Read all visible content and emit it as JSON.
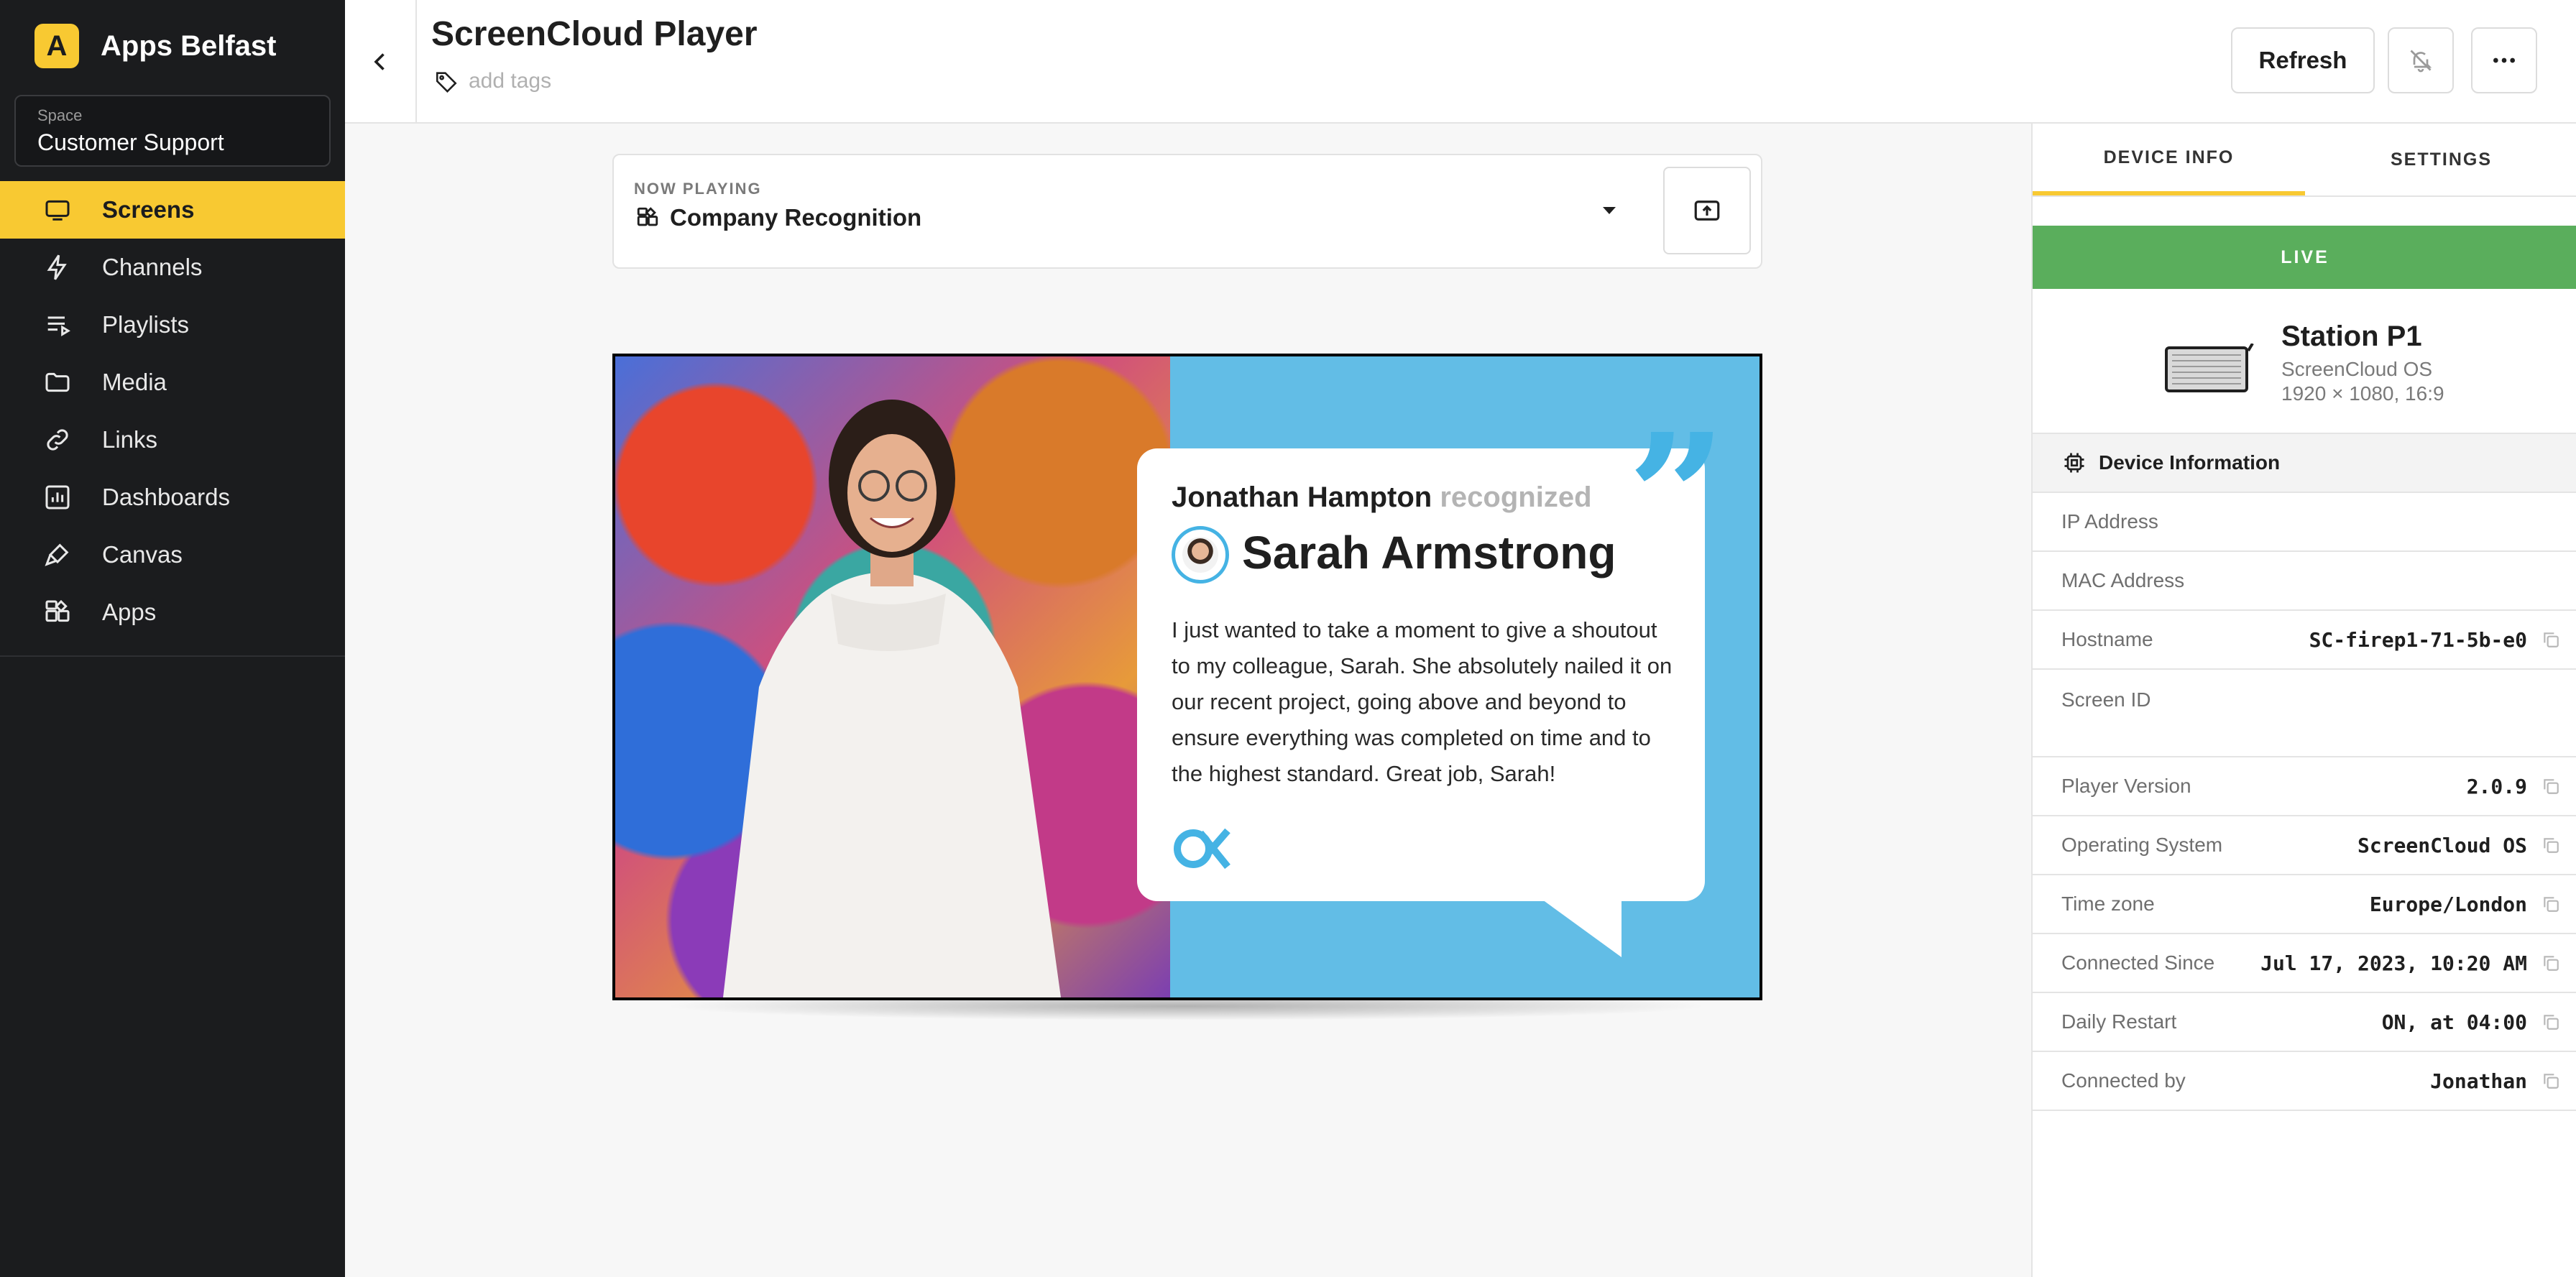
{
  "app": {
    "org_initial": "A",
    "org_name": "Apps Belfast",
    "space_label": "Space",
    "space_value": "Customer Support",
    "accent_color": "#f8c932"
  },
  "sidebar": {
    "items": [
      {
        "label": "Screens",
        "icon": "monitor-icon",
        "active": true
      },
      {
        "label": "Channels",
        "icon": "lightning-icon"
      },
      {
        "label": "Playlists",
        "icon": "playlist-icon"
      },
      {
        "label": "Media",
        "icon": "folder-icon"
      },
      {
        "label": "Links",
        "icon": "link-icon"
      },
      {
        "label": "Dashboards",
        "icon": "dashboard-icon"
      },
      {
        "label": "Canvas",
        "icon": "brush-icon"
      },
      {
        "label": "Apps",
        "icon": "apps-icon"
      }
    ]
  },
  "header": {
    "title": "ScreenCloud Player",
    "tags_placeholder": "add tags",
    "refresh_label": "Refresh"
  },
  "now_playing": {
    "label": "NOW PLAYING",
    "value": "Company Recognition"
  },
  "preview": {
    "from": "Jonathan Hampton",
    "verb": "recognized",
    "to": "Sarah Armstrong",
    "message": "I just wanted to take a moment to give a shoutout to my colleague, Sarah. She absolutely nailed it on our recent project, going above and beyond to ensure everything was completed on time and to the highest standard. Great job, Sarah!"
  },
  "panel": {
    "tabs": [
      "DEVICE INFO",
      "SETTINGS"
    ],
    "status": "LIVE",
    "status_color": "#5aae5c",
    "device_name": "Station P1",
    "device_os": "ScreenCloud OS",
    "device_res": "1920 × 1080, 16:9",
    "section_title": "Device Information",
    "rows": [
      {
        "label": "IP Address",
        "value": ""
      },
      {
        "label": "MAC Address",
        "value": ""
      },
      {
        "label": "Hostname",
        "value": "SC-firep1-71-5b-e0"
      },
      {
        "label": "Screen ID",
        "value": ""
      },
      {
        "label": "Player Version",
        "value": "2.0.9"
      },
      {
        "label": "Operating System",
        "value": "ScreenCloud OS"
      },
      {
        "label": "Time zone",
        "value": "Europe/London"
      },
      {
        "label": "Connected Since",
        "value": "Jul 17, 2023, 10:20 AM"
      },
      {
        "label": "Daily Restart",
        "value": "ON, at 04:00"
      },
      {
        "label": "Connected by",
        "value": "Jonathan"
      }
    ]
  }
}
